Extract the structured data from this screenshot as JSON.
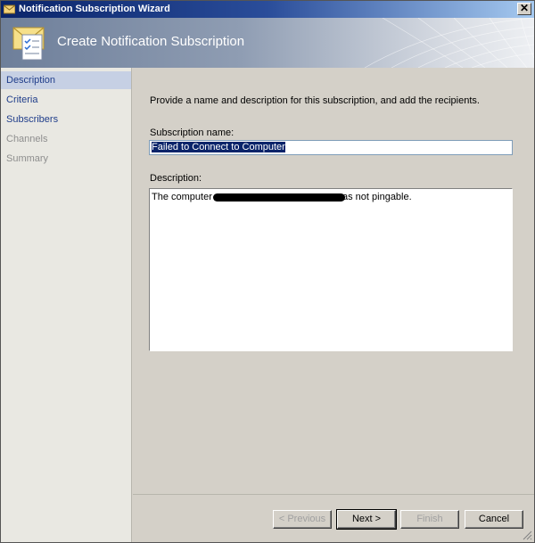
{
  "window": {
    "title": "Notification Subscription Wizard",
    "close_glyph": "✕"
  },
  "banner": {
    "title": "Create Notification Subscription",
    "icon": "subscription-document-icon"
  },
  "steps": [
    {
      "label": "Description",
      "state": "active"
    },
    {
      "label": "Criteria",
      "state": "enabled"
    },
    {
      "label": "Subscribers",
      "state": "enabled"
    },
    {
      "label": "Channels",
      "state": "disabled"
    },
    {
      "label": "Summary",
      "state": "disabled"
    }
  ],
  "main": {
    "intro": "Provide a name and description for this subscription, and add the recipients.",
    "name_label": "Subscription name:",
    "name_value": "Failed to Connect to Computer",
    "description_label": "Description:",
    "description_prefix": "The computer",
    "description_suffix": "as not pingable."
  },
  "buttons": {
    "previous": "< Previous",
    "next": "Next >",
    "finish": "Finish",
    "cancel": "Cancel"
  },
  "colors": {
    "title_bar": "#0a246a",
    "active_step": "#c6d0e4",
    "step_link": "#1f3d8a",
    "selection": "#0a246a"
  }
}
